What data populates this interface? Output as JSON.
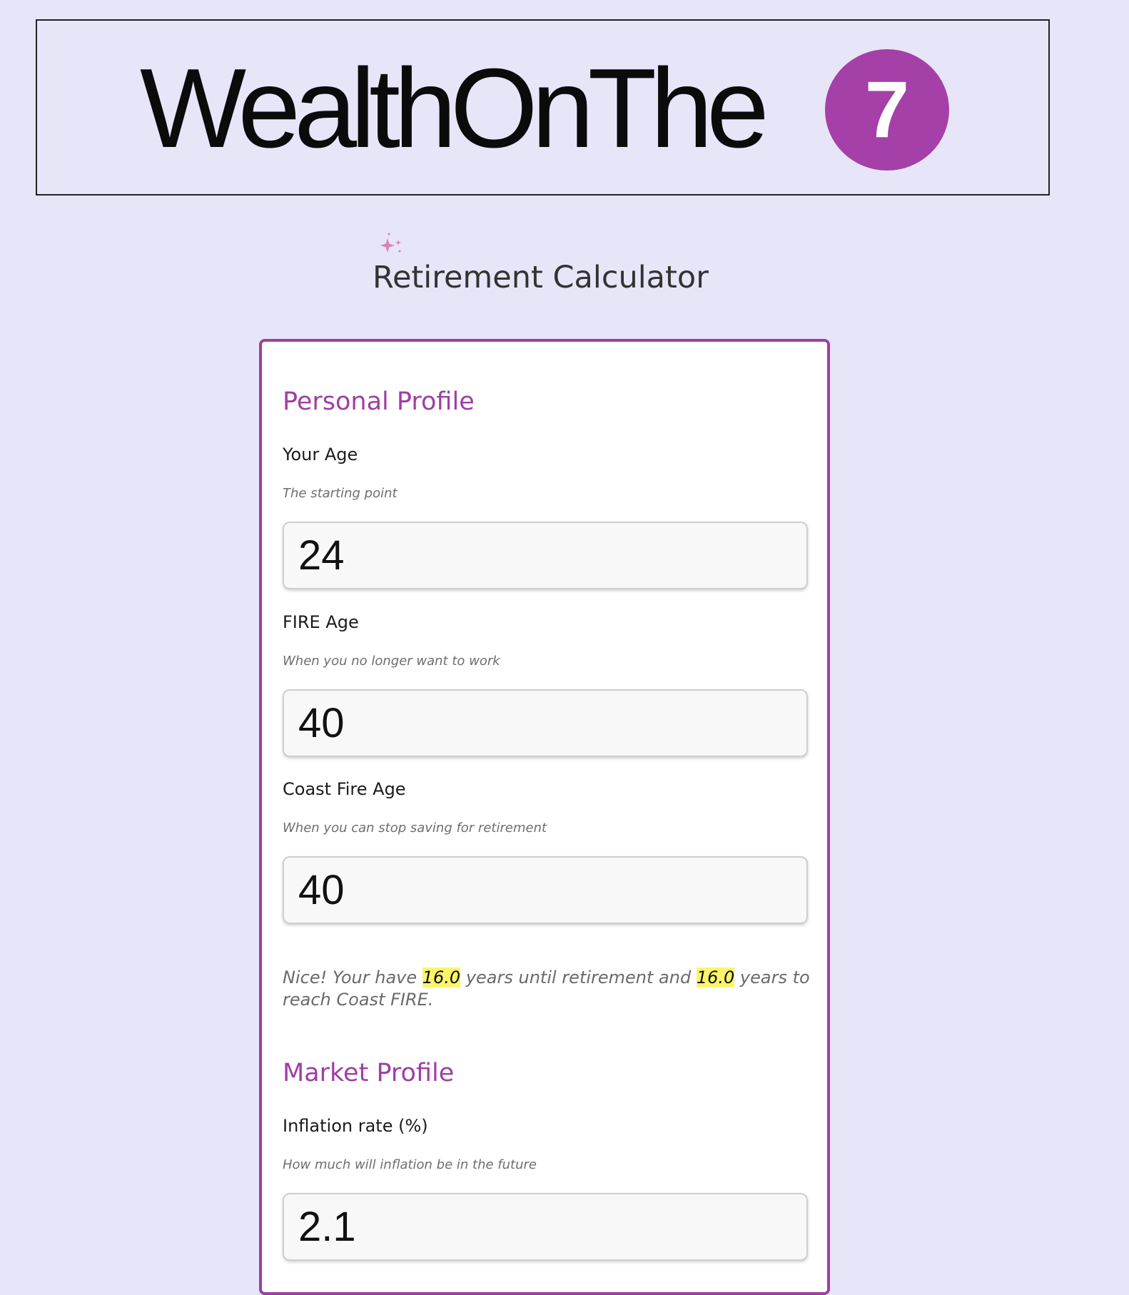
{
  "logo": {
    "text": "WealthOnThe",
    "badge": "7",
    "badge_color": "#a440a7"
  },
  "page": {
    "title": "Retirement Calculator",
    "sparkle_icon": "sparkle-icon"
  },
  "accent_color": "#a03ea4",
  "personal_profile": {
    "title": "Personal Profile",
    "your_age": {
      "label": "Your Age",
      "hint": "The starting point",
      "value": "24"
    },
    "fire_age": {
      "label": "FIRE Age",
      "hint": "When you no longer want to work",
      "value": "40"
    },
    "coast_fire_age": {
      "label": "Coast Fire Age",
      "hint": "When you can stop saving for retirement",
      "value": "40"
    },
    "summary": {
      "part1": "Nice! Your have ",
      "years_to_retirement": "16.0",
      "part2": " years until retirement and ",
      "years_to_coast": "16.0",
      "part3": " years to reach Coast FIRE."
    }
  },
  "market_profile": {
    "title": "Market Profile",
    "inflation_rate": {
      "label": "Inflation rate (%)",
      "hint": "How much will inflation be in the future",
      "value": "2.1"
    }
  }
}
